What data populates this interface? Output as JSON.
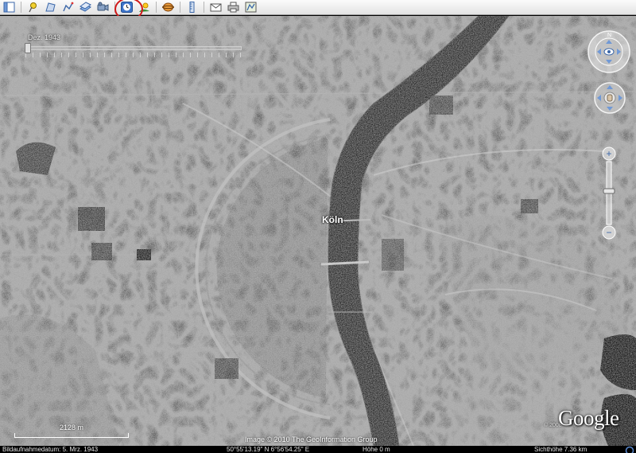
{
  "toolbar": {
    "buttons": [
      {
        "icon": "sidebar-toggle-icon"
      },
      {
        "icon": "placemark-icon"
      },
      {
        "icon": "polygon-icon"
      },
      {
        "icon": "path-icon"
      },
      {
        "icon": "image-overlay-icon"
      },
      {
        "icon": "record-tour-icon"
      },
      {
        "icon": "historical-imagery-clock-icon",
        "highlighted": true
      },
      {
        "icon": "sunlight-icon"
      },
      {
        "icon": "planet-switch-icon"
      },
      {
        "icon": "ruler-icon"
      },
      {
        "icon": "email-icon"
      },
      {
        "icon": "print-icon"
      },
      {
        "icon": "view-in-maps-icon"
      }
    ],
    "highlight_color": "#d11a1a"
  },
  "map": {
    "city_label": "Köln",
    "time_slider": {
      "date_label": "Dez. 1943"
    },
    "scale_bar_label": "2128 m",
    "copyright": "Image © 2010 The GeoInformation Group",
    "logo_text": "Google",
    "logo_year": "© 2008"
  },
  "status_bar": {
    "imagery_date": "Bildaufnahmedatum:  5. Mrz. 1943",
    "coordinates": "50°55'13.19\" N    6°56'54.25\" E",
    "elevation": "Höhe    0 m",
    "eye_altitude": "Sichthöhe    7.36 km"
  },
  "colors": {
    "toolbar_bg": "#ebebeb",
    "river": "#2a2a2a",
    "map_text": "#ffffff"
  }
}
